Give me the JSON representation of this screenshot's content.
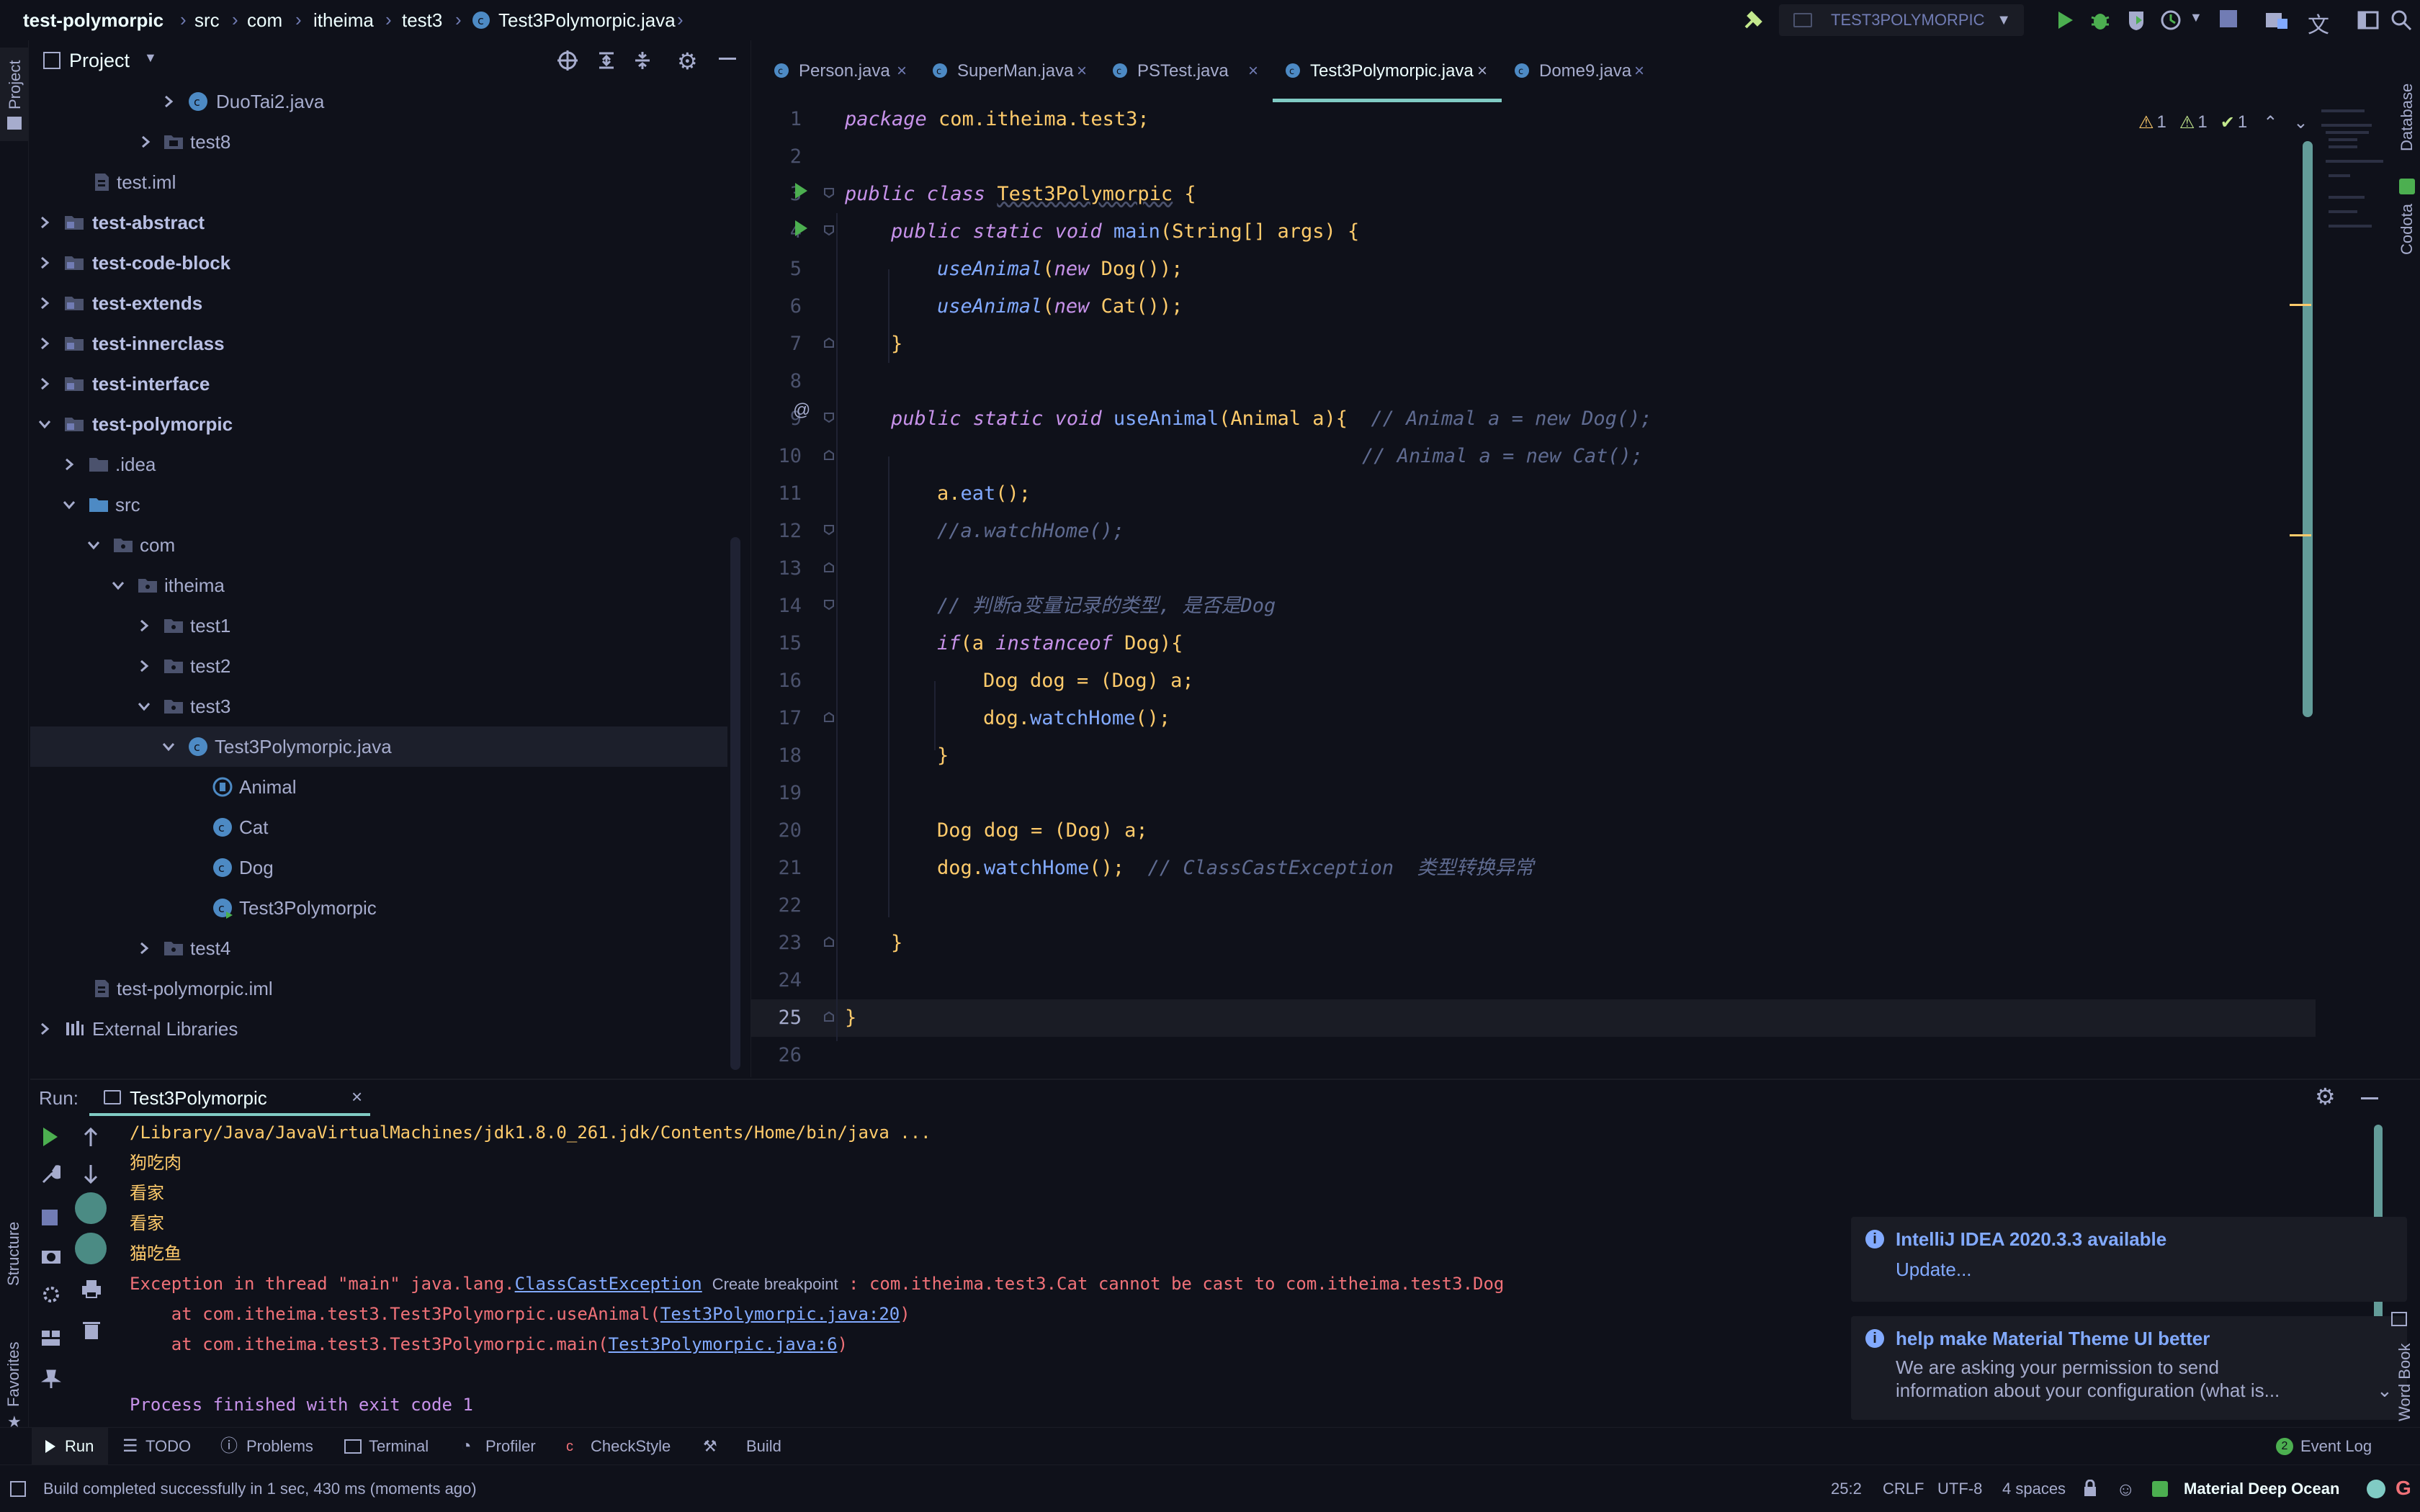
{
  "navbar": {
    "crumbs": [
      "test-polymorpic",
      "src",
      "com",
      "itheima",
      "test3",
      "Test3Polymorpic.java"
    ],
    "run_config": "TEST3POLYMORPIC"
  },
  "left_stripe": {
    "project": "Project",
    "structure": "Structure",
    "favorites": "Favorites"
  },
  "right_stripe": {
    "database": "Database",
    "codota": "Codota",
    "wordbook": "Word Book"
  },
  "project": {
    "title": "Project",
    "tree": [
      {
        "label": "DuoTai2.java",
        "type": "java-class"
      },
      {
        "label": "test8",
        "type": "folder"
      },
      {
        "label": "test.iml",
        "type": "iml"
      },
      {
        "label": "test-abstract",
        "type": "module"
      },
      {
        "label": "test-code-block",
        "type": "module"
      },
      {
        "label": "test-extends",
        "type": "module"
      },
      {
        "label": "test-innerclass",
        "type": "module"
      },
      {
        "label": "test-interface",
        "type": "module"
      },
      {
        "label": "test-polymorpic",
        "type": "module"
      },
      {
        "label": ".idea",
        "type": "folder"
      },
      {
        "label": "src",
        "type": "src-folder"
      },
      {
        "label": "com",
        "type": "package"
      },
      {
        "label": "itheima",
        "type": "package"
      },
      {
        "label": "test1",
        "type": "package"
      },
      {
        "label": "test2",
        "type": "package"
      },
      {
        "label": "test3",
        "type": "package"
      },
      {
        "label": "Test3Polymorpic.java",
        "type": "java-class"
      },
      {
        "label": "Animal",
        "type": "abstract-class"
      },
      {
        "label": "Cat",
        "type": "class"
      },
      {
        "label": "Dog",
        "type": "class"
      },
      {
        "label": "Test3Polymorpic",
        "type": "main-class"
      },
      {
        "label": "test4",
        "type": "package"
      },
      {
        "label": "test-polymorpic.iml",
        "type": "iml"
      },
      {
        "label": "External Libraries",
        "type": "libraries"
      }
    ]
  },
  "editor": {
    "tabs": [
      "Person.java",
      "SuperMan.java",
      "PSTest.java",
      "Test3Polymorpic.java",
      "Dome9.java"
    ],
    "active_tab": "Test3Polymorpic.java",
    "inspections": {
      "warnings": "1",
      "weak_warnings": "1",
      "ok": "1"
    },
    "line_numbers": [
      "1",
      "2",
      "3",
      "4",
      "5",
      "6",
      "7",
      "8",
      "9",
      "10",
      "11",
      "12",
      "13",
      "14",
      "15",
      "16",
      "17",
      "18",
      "19",
      "20",
      "21",
      "22",
      "23",
      "24",
      "25",
      "26"
    ],
    "code": {
      "l1_kw": "package",
      "l1_rest": " com.itheima.test3;",
      "l3_a": "public class ",
      "l3_b": "Test3Polymorpic",
      "l3_c": " {",
      "l4_a": "public static void ",
      "l4_b": "main",
      "l4_c": "(String[] args) {",
      "l5_fn": "useAnimal",
      "l5_b": "(",
      "l5_new": "new ",
      "l5_c": "Dog());",
      "l6_fn": "useAnimal",
      "l6_b": "(",
      "l6_new": "new ",
      "l6_c": "Cat());",
      "l7": "}",
      "l9_a": "public static void ",
      "l9_b": "useAnimal",
      "l9_c": "(Animal a){  ",
      "l9_cm": "// Animal a = new Dog();",
      "l10_cm": "// Animal a = new Cat();",
      "l11_a": "a.",
      "l11_b": "eat",
      "l11_c": "();",
      "l12_cm": "//a.watchHome();",
      "l14_cm": "// 判断a变量记录的类型, 是否是Dog",
      "l15_a": "if",
      "l15_b": "(a ",
      "l15_c": "instanceof",
      "l15_d": " Dog){",
      "l16": "Dog dog = (Dog) a;",
      "l17_a": "dog.",
      "l17_b": "watchHome",
      "l17_c": "();",
      "l18": "}",
      "l20": "Dog dog = (Dog) a;",
      "l21_a": "dog.",
      "l21_b": "watchHome",
      "l21_c": "();  ",
      "l21_cm": "// ClassCastException  类型转换异常",
      "l23": "}",
      "l25": "}"
    }
  },
  "run": {
    "label": "Run:",
    "tab": "Test3Polymorpic",
    "console": {
      "cmd": "/Library/Java/JavaVirtualMachines/jdk1.8.0_261.jdk/Contents/Home/bin/java ...",
      "out1": "狗吃肉",
      "out2": "看家",
      "out3": "看家",
      "out4": "猫吃鱼",
      "exc_prefix": "Exception in thread \"main\" java.lang.",
      "exc_link": "ClassCastException",
      "exc_breakpoint": "Create breakpoint",
      "exc_msg": " : com.itheima.test3.Cat cannot be cast to com.itheima.test3.Dog",
      "trace1_prefix": "    at com.itheima.test3.Test3Polymorpic.useAnimal(",
      "trace1_link": "Test3Polymorpic.java:20",
      "trace1_suffix": ")",
      "trace2_prefix": "    at com.itheima.test3.Test3Polymorpic.main(",
      "trace2_link": "Test3Polymorpic.java:6",
      "trace2_suffix": ")",
      "finished": "Process finished with exit code 1"
    }
  },
  "notifications": [
    {
      "title": "IntelliJ IDEA 2020.3.3 available",
      "link": "Update..."
    },
    {
      "title": "help make Material Theme UI better",
      "line1": "We are asking your permission to send",
      "line2": "information about your configuration (what is..."
    }
  ],
  "tool_tabs": {
    "run": "Run",
    "todo": "TODO",
    "problems": "Problems",
    "terminal": "Terminal",
    "profiler": "Profiler",
    "checkstyle": "CheckStyle",
    "build": "Build",
    "event_log_count": "2",
    "event_log": "Event Log"
  },
  "status": {
    "message": "Build completed successfully in 1 sec, 430 ms (moments ago)",
    "position": "25:2",
    "line_sep": "CRLF",
    "encoding": "UTF-8",
    "indent": "4 spaces",
    "theme": "Material Deep Ocean"
  },
  "colors": {
    "accent": "#80cbc4",
    "background": "#0f111a",
    "keyword": "#c792ea",
    "type": "#ffcb6b",
    "function": "#82aaff",
    "error": "#f07178"
  }
}
